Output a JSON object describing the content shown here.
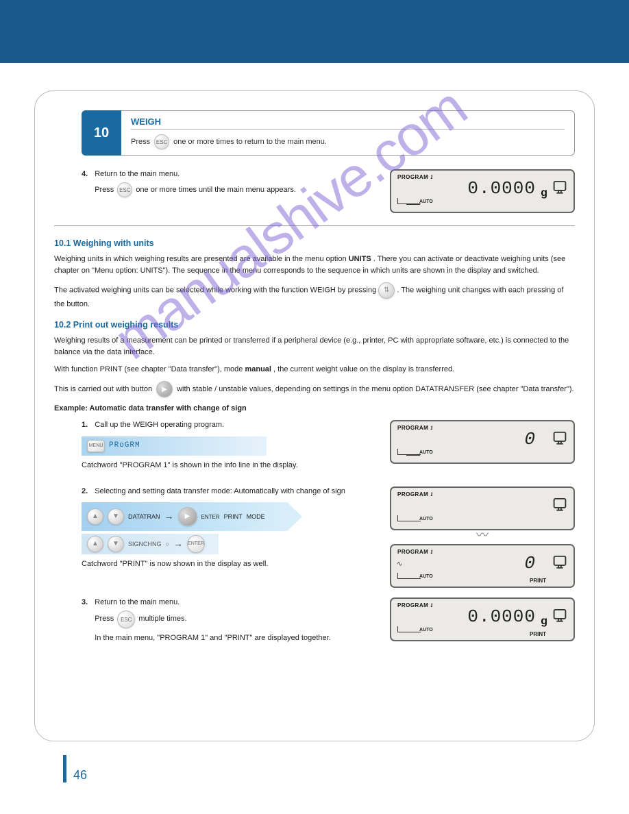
{
  "header": {},
  "section": {
    "number": "10",
    "title": "WEIGH",
    "press_prefix": "Press",
    "press_suffix": "one or more times to return to the main menu."
  },
  "esc_label": "ESC",
  "menu_label": "MENU",
  "enter_label": "ENTER",
  "lcd": {
    "program": "PROGRAM",
    "prog_num": "1",
    "auto": "AUTO",
    "unit_g": "g",
    "zero_val": "0.0000",
    "zero_sym": "0",
    "print": "PRINT"
  },
  "step_a": {
    "num": "4.",
    "text_1": "Return to the main menu.",
    "text_2": "Press",
    "text_3": "one or more times until the main menu appears."
  },
  "sub1": {
    "title": "10.1 Weighing with units",
    "p1_a": "Weighing units in which weighing results are presented are available in the menu option",
    "p1_b": "UNITS",
    "p1_c": ". There you can activate or deactivate weighing units (see chapter on \"Menu option: UNITS\"). The sequence in the menu corresponds to the sequence in which units are shown in the display and switched.",
    "p1_d": "The activated weighing units can be selected while working with the function WEIGH by pressing",
    "p1_e": ". The weighing unit changes with each pressing of the button."
  },
  "sub2": {
    "title": "10.2 Print out weighing results",
    "p1": "Weighing results of a measurement can be printed or transferred if a peripheral device (e.g., printer, PC with appropriate software, etc.) is connected to the balance via the data interface.",
    "p2a": "With function PRINT (see chapter \"Data transfer\"), mode",
    "p2b": "manual",
    "p2c": ", the current weight value on the display is transferred.",
    "help_a": "This is carried out with button",
    "help_b": "with stable / unstable values, depending on settings in the menu option DATATRANSFER (see chapter \"Data transfer\").",
    "ex": "Example: Automatic data transfer with change of sign",
    "step1_n": "1.",
    "step1_t": "Call up the WEIGH operating program.",
    "menu_seg": "PRoGRM",
    "step1_d": "Catchword \"PROGRAM 1\" is shown in the info line in the display.",
    "step2_n": "2.",
    "step2_t": "Selecting and setting data transfer mode: Automatically with change of sign",
    "band_a": "DATATRAN",
    "band_b": "PRINT",
    "band_c": "MODE",
    "band2_a": "SIGNCHNG",
    "step2_d": "Catchword \"PRINT\" is now shown in the display as well.",
    "step3_n": "3.",
    "step3_t": "Return to the main menu.",
    "step3_p": "Press",
    "step3_s": "multiple times.",
    "step3_d": "In the main menu, \"PROGRAM 1\" and \"PRINT\" are displayed together."
  },
  "footer": {
    "page": "46"
  },
  "watermark": "manualshive.com"
}
